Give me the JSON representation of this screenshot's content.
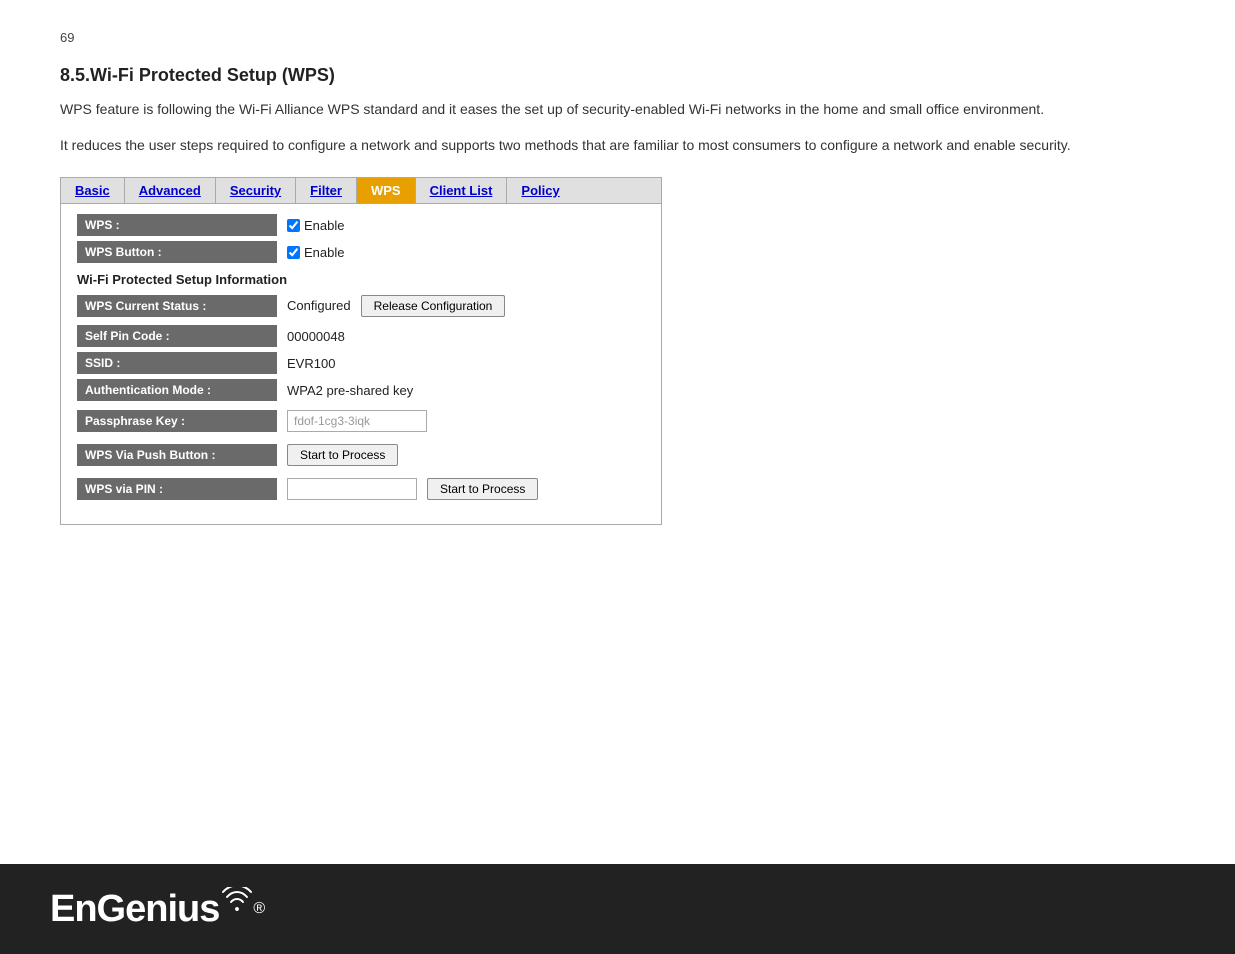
{
  "page": {
    "number": "69",
    "section_number": "8.5.",
    "section_title": "Wi-Fi Protected Setup (WPS)",
    "intro1": "WPS feature is following the Wi-Fi Alliance WPS standard and it eases the set up of security-enabled Wi-Fi networks in the home and small office environment.",
    "intro2": "It reduces the user steps required to configure a network and supports two methods that are familiar to most consumers to configure a network and enable security."
  },
  "tabs": [
    {
      "label": "Basic",
      "active": false
    },
    {
      "label": "Advanced",
      "active": false
    },
    {
      "label": "Security",
      "active": false
    },
    {
      "label": "Filter",
      "active": false
    },
    {
      "label": "WPS",
      "active": true
    },
    {
      "label": "Client List",
      "active": false
    },
    {
      "label": "Policy",
      "active": false
    }
  ],
  "form": {
    "section_info": "Wi-Fi Protected Setup Information",
    "rows": [
      {
        "label": "WPS :",
        "type": "checkbox",
        "value": "Enable",
        "checked": true
      },
      {
        "label": "WPS Button :",
        "type": "checkbox",
        "value": "Enable",
        "checked": true
      }
    ],
    "info_rows": [
      {
        "label": "WPS Current Status :",
        "value": "Configured",
        "has_button": true,
        "button_label": "Release Configuration"
      },
      {
        "label": "Self Pin Code :",
        "value": "00000048",
        "has_button": false
      },
      {
        "label": "SSID :",
        "value": "EVR100",
        "has_button": false
      },
      {
        "label": "Authentication Mode :",
        "value": "WPA2 pre-shared key",
        "has_button": false
      },
      {
        "label": "Passphrase Key :",
        "value": "fdof-1cg3-3iqk",
        "type": "text_input",
        "has_button": false
      },
      {
        "label": "WPS Via Push Button :",
        "value": "",
        "type": "button_only",
        "button_label": "Start to Process"
      },
      {
        "label": "WPS via PIN :",
        "value": "",
        "type": "pin_input",
        "button_label": "Start to Process"
      }
    ]
  },
  "footer": {
    "logo": "EnGenius",
    "registered": "®"
  }
}
